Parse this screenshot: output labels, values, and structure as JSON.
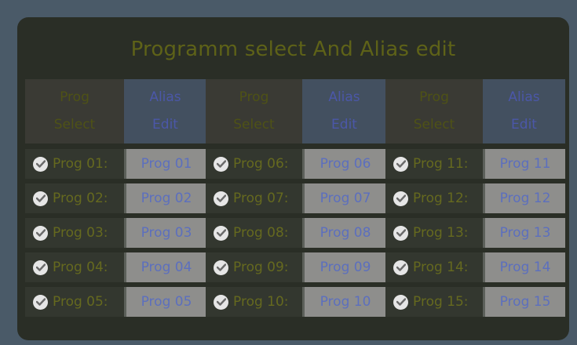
{
  "title": "Programm select And Alias edit",
  "headers": [
    {
      "line1": "Prog",
      "line2": "Select"
    },
    {
      "line1": "Alias",
      "line2": "Edit"
    }
  ],
  "columns": [
    [
      {
        "label": "Prog 01:",
        "alias": "Prog 01"
      },
      {
        "label": "Prog 02:",
        "alias": "Prog 02"
      },
      {
        "label": "Prog 03:",
        "alias": "Prog 03"
      },
      {
        "label": "Prog 04:",
        "alias": "Prog 04"
      },
      {
        "label": "Prog 05:",
        "alias": "Prog 05"
      }
    ],
    [
      {
        "label": "Prog 06:",
        "alias": "Prog 06"
      },
      {
        "label": "Prog 07:",
        "alias": "Prog 07"
      },
      {
        "label": "Prog 08:",
        "alias": "Prog 08"
      },
      {
        "label": "Prog 09:",
        "alias": "Prog 09"
      },
      {
        "label": "Prog 10:",
        "alias": "Prog 10"
      }
    ],
    [
      {
        "label": "Prog 11:",
        "alias": "Prog 11"
      },
      {
        "label": "Prog 12:",
        "alias": "Prog 12"
      },
      {
        "label": "Prog 13:",
        "alias": "Prog 13"
      },
      {
        "label": "Prog 14:",
        "alias": "Prog 14"
      },
      {
        "label": "Prog 15:",
        "alias": "Prog 15"
      }
    ]
  ]
}
